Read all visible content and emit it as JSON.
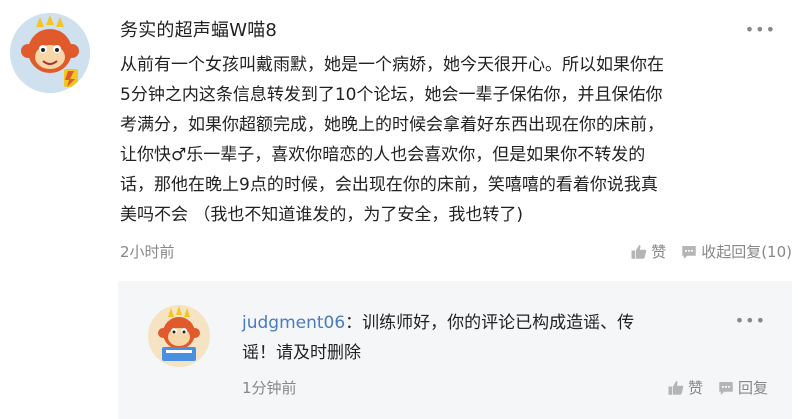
{
  "comment": {
    "username": "务实的超声蝠W喵8",
    "more_icon": "more-dots-icon",
    "lines": [
      "从前有一个女孩叫戴雨默，她是一个病娇，她今天很开心。所以如果你在",
      "5分钟之内这条信息转发到了10个论坛，她会一辈子保佑你，并且保佑你",
      "考满分，如果你超额完成，她晚上的时候会拿着好东西出现在你的床前，",
      "让你快♂乐一辈子，喜欢你暗恋的人也会喜欢你，但是如果你不转发的",
      "话，那他在晚上9点的时候，会出现在你的床前，笑嘻嘻的看着你说我真",
      "美吗不会 （我也不知道谁发的，为了安全，我也转了)"
    ],
    "time": "2小时前",
    "like_label": "赞",
    "reply_label": "收起回复(10)"
  },
  "reply": {
    "username": "judgment06",
    "text_line1": "：训练师好，你的评论已构成造谣、传",
    "text_line2": "谣！请及时删除",
    "time": "1分钟前",
    "like_label": "赞",
    "reply_label": "回复"
  }
}
